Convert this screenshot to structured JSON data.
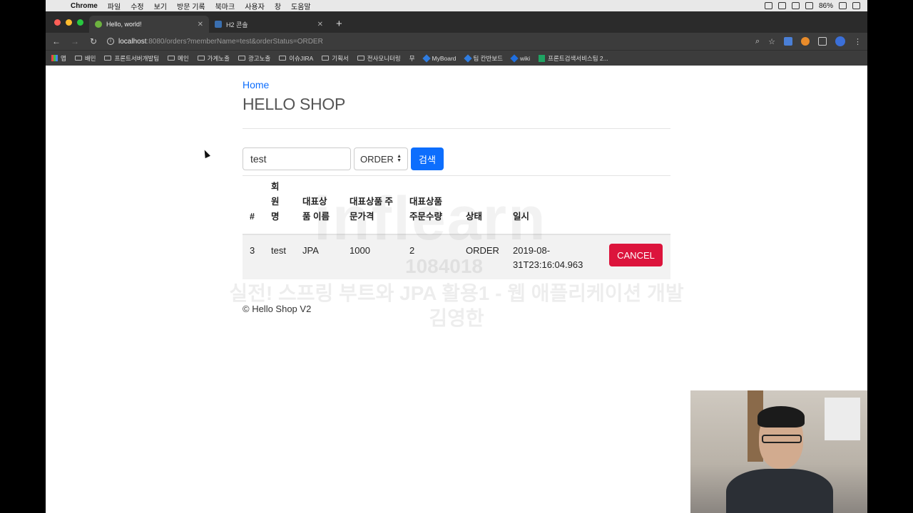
{
  "menubar": {
    "app": "Chrome",
    "items": [
      "파일",
      "수정",
      "보기",
      "방문 기록",
      "북마크",
      "사용자",
      "창",
      "도움말"
    ],
    "battery": "86%"
  },
  "browser": {
    "tabs": [
      {
        "title": "Hello, world!",
        "active": true
      },
      {
        "title": "H2 콘솔",
        "active": false
      }
    ],
    "url_host": "localhost",
    "url_rest": ":8080/orders?memberName=test&orderStatus=ORDER",
    "bookmarks": [
      "앱",
      "배민",
      "프론트서버개발팀",
      "메인",
      "가게노출",
      "광고노출",
      "이슈JIRA",
      "기획서",
      "전사모니터링",
      "무",
      "MyBoard",
      "팀 칸반보드",
      "wiki",
      "프론트검색서비스팀 2..."
    ]
  },
  "page": {
    "home_link": "Home",
    "title": "HELLO SHOP",
    "search": {
      "member_name_value": "test",
      "status_selected": "ORDER",
      "search_button": "검색"
    },
    "table": {
      "headers": [
        "#",
        "회\n원\n명",
        "대표상\n품 이름",
        "대표상품 주\n문가격",
        "대표상품\n주문수량",
        "상태",
        "일시"
      ],
      "rows": [
        {
          "id": "3",
          "member": "test",
          "item": "JPA",
          "price": "1000",
          "count": "2",
          "status": "ORDER",
          "date": "2019-08-\n31T23:16:04.963",
          "action": "CANCEL"
        }
      ]
    },
    "footer": "© Hello Shop V2"
  },
  "watermark": {
    "logo": "inflearn",
    "id": "1084018",
    "course": "실전! 스프링 부트와 JPA 활용1 - 웹 애플리케이션 개발",
    "author": "김영한"
  },
  "colors": {
    "primary": "#0d6efd",
    "danger": "#dc143c",
    "link": "#0d6efd"
  }
}
